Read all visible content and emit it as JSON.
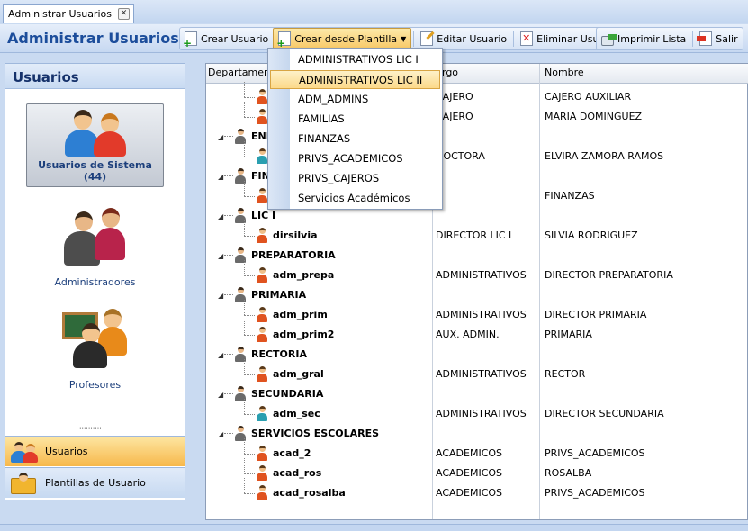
{
  "window": {
    "tab_title": "Administrar Usuarios"
  },
  "toolbar": {
    "title": "Administrar Usuarios",
    "buttons": {
      "crear_usuario": "Crear Usuario",
      "crear_desde_plantilla": "Crear desde Plantilla",
      "editar_usuario": "Editar Usuario",
      "eliminar_usuario": "Eliminar Usuario",
      "imprimir_lista": "Imprimir Lista",
      "salir": "Salir"
    }
  },
  "template_menu": {
    "items": [
      "ADMINISTRATIVOS LIC I",
      "ADMINISTRATIVOS LIC II",
      "ADM_ADMINS",
      "FAMILIAS",
      "FINANZAS",
      "PRIVS_ACADEMICOS",
      "PRIVS_CAJEROS",
      "Servicios Académicos"
    ],
    "highlighted": "ADMINISTRATIVOS LIC II"
  },
  "sidebar": {
    "header": "Usuarios",
    "items": [
      {
        "label": "Usuarios de Sistema (44)",
        "selected": true
      },
      {
        "label": "Administradores",
        "selected": false
      },
      {
        "label": "Profesores",
        "selected": false
      }
    ],
    "grip": "''''''''''",
    "nav": [
      {
        "label": "Usuarios",
        "active": true
      },
      {
        "label": "Plantillas de Usuario",
        "active": false
      }
    ]
  },
  "grid": {
    "columns": {
      "departamento": "Departamento",
      "cargo": "rgo",
      "nombre": "Nombre"
    },
    "rows": [
      {
        "type": "user",
        "name": "",
        "cargo": "CAJERO",
        "nombre": "CAJERO AUXILIAR"
      },
      {
        "type": "user",
        "name": "",
        "cargo": "CAJERO",
        "nombre": "MARIA DOMINGUEZ"
      },
      {
        "type": "group",
        "name": "ENF"
      },
      {
        "type": "user",
        "name": "",
        "cargo": "DOCTORA",
        "nombre": "ELVIRA ZAMORA RAMOS"
      },
      {
        "type": "group",
        "name": "FINA"
      },
      {
        "type": "user",
        "name": "",
        "cargo": "",
        "nombre": "FINANZAS"
      },
      {
        "type": "group",
        "name": "LIC I"
      },
      {
        "type": "user",
        "name": "dirsilvia",
        "cargo": "DIRECTOR LIC I",
        "nombre": "SILVIA RODRIGUEZ"
      },
      {
        "type": "group",
        "name": "PREPARATORIA"
      },
      {
        "type": "user",
        "name": "adm_prepa",
        "cargo": "ADMINISTRATIVOS",
        "nombre": "DIRECTOR PREPARATORIA"
      },
      {
        "type": "group",
        "name": "PRIMARIA"
      },
      {
        "type": "user",
        "name": "adm_prim",
        "cargo": "ADMINISTRATIVOS",
        "nombre": "DIRECTOR PRIMARIA"
      },
      {
        "type": "user",
        "name": "adm_prim2",
        "cargo": "AUX. ADMIN.",
        "nombre": "PRIMARIA"
      },
      {
        "type": "group",
        "name": "RECTORIA"
      },
      {
        "type": "user",
        "name": "adm_gral",
        "cargo": "ADMINISTRATIVOS",
        "nombre": "RECTOR"
      },
      {
        "type": "group",
        "name": "SECUNDARIA"
      },
      {
        "type": "user",
        "name": "adm_sec",
        "cargo": "ADMINISTRATIVOS",
        "nombre": "DIRECTOR SECUNDARIA"
      },
      {
        "type": "group",
        "name": "SERVICIOS ESCOLARES"
      },
      {
        "type": "user",
        "name": "acad_2",
        "cargo": "ACADEMICOS",
        "nombre": "PRIVS_ACADEMICOS"
      },
      {
        "type": "user",
        "name": "acad_ros",
        "cargo": "ACADEMICOS",
        "nombre": "ROSALBA"
      },
      {
        "type": "user",
        "name": "acad_rosalba",
        "cargo": "ACADEMICOS",
        "nombre": "PRIVS_ACADEMICOS"
      }
    ]
  },
  "colors": {
    "accent": "#1c4d9b",
    "highlight": "#fcd98a",
    "nav_active": "#f7b84b"
  },
  "icons": {
    "user_male_orange": "user-icon",
    "user_male_teal": "user-icon",
    "group": "group-icon"
  }
}
